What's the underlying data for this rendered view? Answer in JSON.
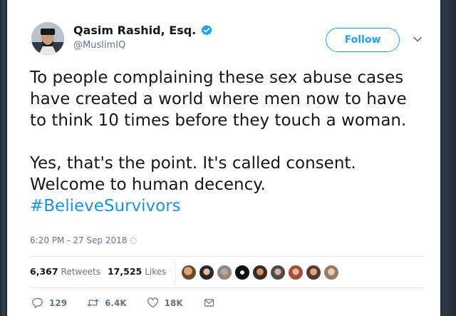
{
  "tweet": {
    "author_name": "Qasim Rashid, Esq.",
    "handle": "@MuslimIQ",
    "follow_label": "Follow",
    "text_lines": [
      "To people complaining these sex abuse cases",
      "have created a world where men now to have",
      "to think 10 times before they touch a woman."
    ],
    "text_lines_2": [
      "Yes, that's the point. It's called consent.",
      "Welcome to human decency."
    ],
    "hashtag": "#BelieveSurvivors",
    "timestamp": "6:20 PM - 27 Sep 2018"
  },
  "stats": {
    "retweets_count": "6,367",
    "retweets_label": "Retweets",
    "likes_count": "17,525",
    "likes_label": "Likes",
    "liker_avatar_count": 9
  },
  "actions": {
    "reply_count": "129",
    "retweet_count": "6.4K",
    "like_count": "18K"
  },
  "colors": {
    "accent": "#1da1f2",
    "hashtag": "#1b95e0",
    "muted": "#657786",
    "text": "#14171a"
  },
  "icons": [
    "verified-badge-icon",
    "chevron-down-icon",
    "loading-spinner-icon",
    "reply-icon",
    "retweet-icon",
    "like-icon",
    "direct-message-icon"
  ]
}
